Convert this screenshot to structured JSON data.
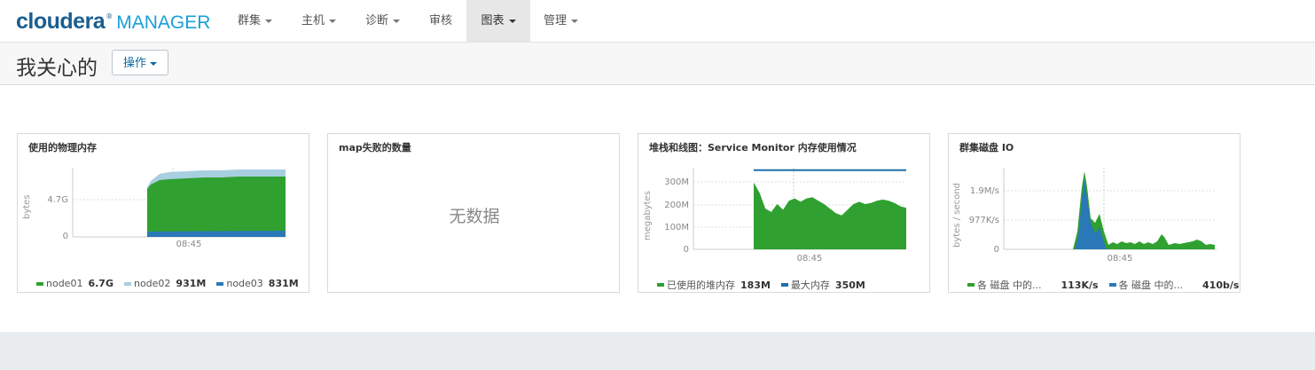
{
  "brand": {
    "name_a": "cloudera",
    "name_b": "MANAGER"
  },
  "nav": [
    {
      "label": "群集",
      "dropdown": true,
      "active": false
    },
    {
      "label": "主机",
      "dropdown": true,
      "active": false
    },
    {
      "label": "诊断",
      "dropdown": true,
      "active": false
    },
    {
      "label": "审核",
      "dropdown": false,
      "active": false
    },
    {
      "label": "图表",
      "dropdown": true,
      "active": true
    },
    {
      "label": "管理",
      "dropdown": true,
      "active": false
    }
  ],
  "page": {
    "title": "我关心的",
    "action_label": "操作"
  },
  "colors": {
    "green": "#30a030",
    "light_blue": "#a8cfe0",
    "blue": "#2a78b8",
    "navy": "#1f6fa8"
  },
  "panels": {
    "memory": {
      "title": "使用的物理内存",
      "ylabel": "bytes",
      "yticks": [
        "4.7G",
        "0"
      ],
      "xtick": "08:45",
      "legend": [
        {
          "name": "node01",
          "value": "6.7G",
          "color": "#30a030"
        },
        {
          "name": "node02",
          "value": "931M",
          "color": "#a8cfe0"
        },
        {
          "name": "node03",
          "value": "831M",
          "color": "#2a78b8"
        }
      ]
    },
    "map": {
      "title": "map失败的数量",
      "empty_text": "无数据"
    },
    "heap": {
      "title": "堆栈和线图：Service Monitor 内存使用情况",
      "ylabel": "megabytes",
      "yticks": [
        "300M",
        "200M",
        "100M",
        "0"
      ],
      "xtick": "08:45",
      "legend": [
        {
          "name": "已使用的堆内存",
          "value": "183M",
          "color": "#30a030"
        },
        {
          "name": "最大内存",
          "value": "350M",
          "color": "#1f6fa8"
        }
      ]
    },
    "disk": {
      "title": "群集磁盘 IO",
      "ylabel": "bytes / second",
      "yticks": [
        "1.9M/s",
        "977K/s",
        "0"
      ],
      "xtick": "08:45",
      "legend": [
        {
          "name": "各 磁盘 中的...",
          "value": "113K/s",
          "color": "#30a030"
        },
        {
          "name": "各 磁盘 中的...",
          "value": "410b/s",
          "color": "#2a78b8"
        }
      ]
    }
  },
  "chart_data": [
    {
      "type": "area",
      "title": "使用的物理内存",
      "ylabel": "bytes",
      "x_tick": "08:45",
      "ylim_label_ticks": [
        "0",
        "4.7G"
      ],
      "series": [
        {
          "name": "node01",
          "last_value": "6.7G"
        },
        {
          "name": "node02",
          "last_value": "931M"
        },
        {
          "name": "node03",
          "last_value": "831M"
        }
      ]
    },
    {
      "type": "area",
      "title": "堆栈和线图：Service Monitor 内存使用情况",
      "ylabel": "megabytes",
      "x_tick": "08:45",
      "y_ticks": [
        "0",
        "100M",
        "200M",
        "300M"
      ],
      "series": [
        {
          "name": "已使用的堆内存",
          "last_value": "183M",
          "values_mb": [
            295,
            250,
            180,
            165,
            200,
            175,
            215,
            225,
            210,
            225,
            230,
            215,
            200,
            180,
            160,
            150,
            175,
            200,
            210,
            200,
            205,
            215,
            220,
            215,
            205,
            190,
            183
          ]
        },
        {
          "name": "最大内存",
          "last_value": "350M",
          "values_mb": [
            350,
            350
          ]
        }
      ]
    },
    {
      "type": "area",
      "title": "群集磁盘 IO",
      "ylabel": "bytes / second",
      "x_tick": "08:45",
      "y_ticks": [
        "0",
        "977K/s",
        "1.9M/s"
      ],
      "series": [
        {
          "name": "各 磁盘 中的...",
          "last_value": "113K/s"
        },
        {
          "name": "各 磁盘 中的...",
          "last_value": "410b/s"
        }
      ]
    }
  ]
}
